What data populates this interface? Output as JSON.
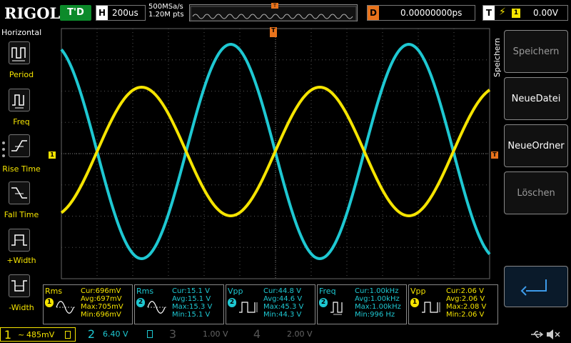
{
  "header": {
    "brand": "RIGOL",
    "run_status": "T'D",
    "timebase_label": "H",
    "timebase_value": "200us",
    "sample_rate": "500MSa/s",
    "memory_depth": "1.20M pts",
    "trigger_marker": "T",
    "delay_label": "D",
    "delay_value": "0.00000000ps",
    "trigger_label": "T",
    "trigger_edge_icon": "rising-edge-icon",
    "trigger_source": "1",
    "trigger_level": "0.00V"
  },
  "left_panel": {
    "title": "Horizontal",
    "items": [
      {
        "label": "Period",
        "icon": "period-icon"
      },
      {
        "label": "Freq",
        "icon": "freq-icon"
      },
      {
        "label": "Rise Time",
        "icon": "rise-time-icon"
      },
      {
        "label": "Fall Time",
        "icon": "fall-time-icon"
      },
      {
        "label": "+Width",
        "icon": "pos-width-icon"
      },
      {
        "label": "-Width",
        "icon": "neg-width-icon"
      }
    ]
  },
  "right_panel": {
    "title": "Speichern",
    "buttons": [
      {
        "label": "Speichern",
        "enabled": false
      },
      {
        "label": "NeueDatei",
        "enabled": true
      },
      {
        "label": "NeueOrdner",
        "enabled": true
      },
      {
        "label": "Löschen",
        "enabled": false
      }
    ],
    "enter_icon": "enter-icon"
  },
  "screen": {
    "ch1_marker": "1",
    "trigger_level_marker": "T",
    "trigger_position_marker": "T"
  },
  "measurements": [
    {
      "name": "Rms",
      "channel": "1",
      "cur": "Cur:696mV",
      "avg": "Avg:697mV",
      "max": "Max:705mV",
      "min": "Min:696mV",
      "icon": "rms-wave-icon"
    },
    {
      "name": "Rms",
      "channel": "2",
      "cur": "Cur:15.1 V",
      "avg": "Avg:15.1 V",
      "max": "Max:15.3 V",
      "min": "Min:15.1 V",
      "icon": "rms-wave-icon"
    },
    {
      "name": "Vpp",
      "channel": "2",
      "cur": "Cur:44.8 V",
      "avg": "Avg:44.6 V",
      "max": "Max:45.3 V",
      "min": "Min:44.3 V",
      "icon": "vpp-icon"
    },
    {
      "name": "Freq",
      "channel": "2",
      "cur": "Cur:1.00kHz",
      "avg": "Avg:1.00kHz",
      "max": "Max:1.00kHz",
      "min": "Min:996 Hz",
      "icon": "freq-icon"
    },
    {
      "name": "Vpp",
      "channel": "1",
      "cur": "Cur:2.06 V",
      "avg": "Avg:2.06 V",
      "max": "Max:2.08 V",
      "min": "Min:2.06 V",
      "icon": "vpp-icon"
    }
  ],
  "channels": [
    {
      "num": "1",
      "coupling": "~",
      "scale": "485mV",
      "active": true
    },
    {
      "num": "2",
      "coupling": "",
      "scale": "6.40 V",
      "active": true
    },
    {
      "num": "3",
      "coupling": "",
      "scale": "1.00 V",
      "active": false
    },
    {
      "num": "4",
      "coupling": "",
      "scale": "2.00 V",
      "active": false
    }
  ],
  "status_icons": [
    "usb-icon",
    "sound-muted-icon"
  ],
  "colors": {
    "ch1": "#f5e400",
    "ch2": "#1ec8d2",
    "trigger": "#e8731c",
    "run": "#0c8a2a"
  }
}
